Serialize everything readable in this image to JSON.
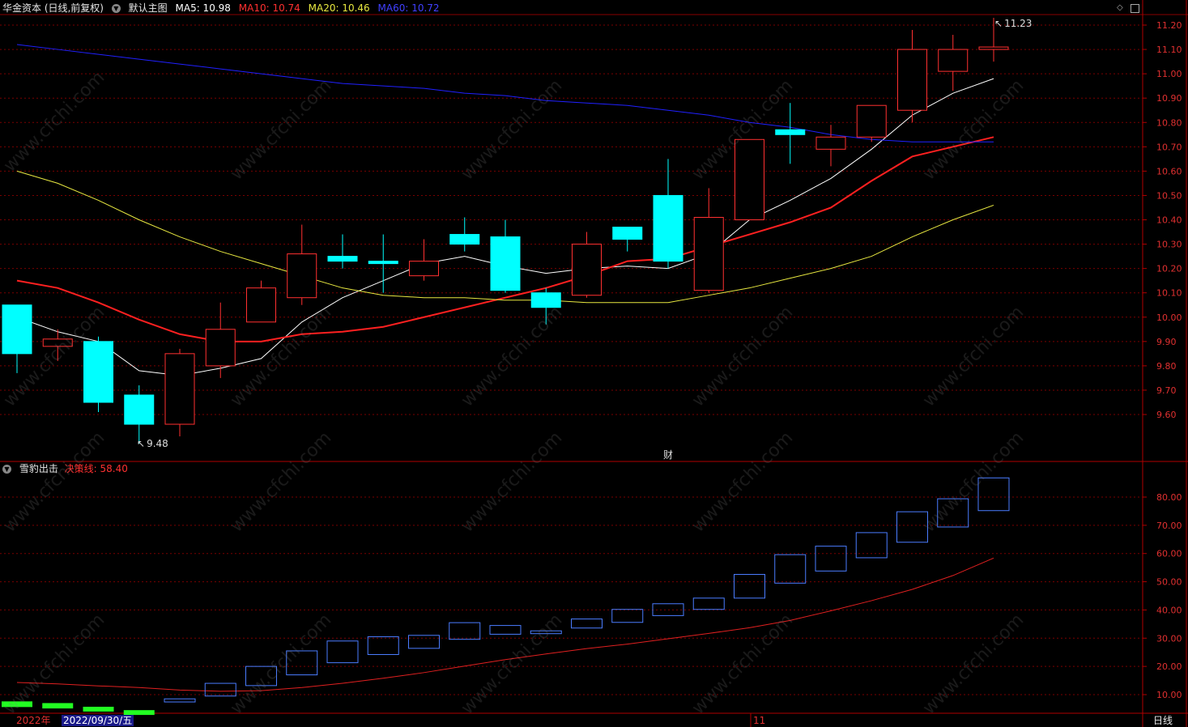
{
  "header": {
    "stock_name": "华金资本 (日线,前复权)",
    "main_chart_label": "默认主图",
    "ma5_label": "MA5: 10.98",
    "ma10_label": "MA10: 10.74",
    "ma20_label": "MA20: 10.46",
    "ma60_label": "MA60: 10.72"
  },
  "sub_header": {
    "indicator_name": "雪豹出击",
    "decision_label": "决策线: 58.40"
  },
  "annotations": {
    "high_mark": "11.23",
    "low_mark": "9.48",
    "finance_marker": "财"
  },
  "footer": {
    "year_label": "2022年",
    "date_label": "2022/09/30/五",
    "month_label": "11",
    "period_button": "日线"
  },
  "watermark": "www.cfchi.com",
  "colors": {
    "up": "#ff3030",
    "down": "#00ffff",
    "ma5": "#ffffff",
    "ma10": "#ff2020",
    "ma20": "#e8e840",
    "ma60": "#2020ff",
    "grid": "#7a0000",
    "axis_text": "#e03030",
    "indicator_box": "#4a7cff",
    "indicator_neg": "#22ff22",
    "decision_line": "#e02020"
  },
  "chart_data": [
    {
      "type": "candlestick",
      "title": "华金资本 (日线,前复权)",
      "y_ticks": [
        9.6,
        9.7,
        9.8,
        9.9,
        10.0,
        10.1,
        10.2,
        10.3,
        10.4,
        10.5,
        10.6,
        10.7,
        10.8,
        10.9,
        11.0,
        11.1,
        11.2
      ],
      "ylim": [
        9.45,
        11.25
      ],
      "grid": true,
      "candles": [
        {
          "o": 10.05,
          "h": 10.05,
          "l": 9.77,
          "c": 9.85
        },
        {
          "o": 9.88,
          "h": 9.95,
          "l": 9.82,
          "c": 9.91
        },
        {
          "o": 9.9,
          "h": 9.92,
          "l": 9.61,
          "c": 9.65
        },
        {
          "o": 9.68,
          "h": 9.72,
          "l": 9.48,
          "c": 9.56
        },
        {
          "o": 9.56,
          "h": 9.87,
          "l": 9.51,
          "c": 9.85
        },
        {
          "o": 9.8,
          "h": 10.06,
          "l": 9.75,
          "c": 9.95
        },
        {
          "o": 9.98,
          "h": 10.15,
          "l": 9.98,
          "c": 10.12
        },
        {
          "o": 10.08,
          "h": 10.38,
          "l": 10.05,
          "c": 10.26
        },
        {
          "o": 10.25,
          "h": 10.34,
          "l": 10.2,
          "c": 10.23
        },
        {
          "o": 10.23,
          "h": 10.34,
          "l": 10.1,
          "c": 10.22
        },
        {
          "o": 10.17,
          "h": 10.32,
          "l": 10.15,
          "c": 10.23
        },
        {
          "o": 10.34,
          "h": 10.41,
          "l": 10.27,
          "c": 10.3
        },
        {
          "o": 10.33,
          "h": 10.4,
          "l": 10.1,
          "c": 10.11
        },
        {
          "o": 10.1,
          "h": 10.12,
          "l": 9.97,
          "c": 10.04
        },
        {
          "o": 10.09,
          "h": 10.35,
          "l": 10.08,
          "c": 10.3
        },
        {
          "o": 10.37,
          "h": 10.37,
          "l": 10.27,
          "c": 10.32
        },
        {
          "o": 10.5,
          "h": 10.65,
          "l": 10.2,
          "c": 10.23
        },
        {
          "o": 10.11,
          "h": 10.53,
          "l": 10.1,
          "c": 10.41
        },
        {
          "o": 10.4,
          "h": 10.73,
          "l": 10.4,
          "c": 10.73
        },
        {
          "o": 10.77,
          "h": 10.88,
          "l": 10.63,
          "c": 10.75
        },
        {
          "o": 10.69,
          "h": 10.79,
          "l": 10.62,
          "c": 10.74
        },
        {
          "o": 10.74,
          "h": 10.86,
          "l": 10.72,
          "c": 10.87
        },
        {
          "o": 10.85,
          "h": 11.18,
          "l": 10.8,
          "c": 11.1
        },
        {
          "o": 11.01,
          "h": 11.16,
          "l": 10.93,
          "c": 11.1
        },
        {
          "o": 11.1,
          "h": 11.23,
          "l": 11.05,
          "c": 11.11
        }
      ],
      "series": [
        {
          "name": "MA5",
          "values": [
            10.0,
            9.94,
            9.9,
            9.78,
            9.76,
            9.79,
            9.83,
            9.98,
            10.08,
            10.15,
            10.22,
            10.25,
            10.21,
            10.18,
            10.2,
            10.21,
            10.2,
            10.26,
            10.4,
            10.48,
            10.57,
            10.69,
            10.83,
            10.92,
            10.98
          ]
        },
        {
          "name": "MA10",
          "values": [
            10.15,
            10.12,
            10.06,
            9.99,
            9.93,
            9.9,
            9.9,
            9.93,
            9.94,
            9.96,
            10.0,
            10.04,
            10.08,
            10.12,
            10.17,
            10.23,
            10.24,
            10.29,
            10.34,
            10.39,
            10.45,
            10.56,
            10.66,
            10.7,
            10.74
          ]
        },
        {
          "name": "MA20",
          "values": [
            10.6,
            10.55,
            10.48,
            10.4,
            10.33,
            10.27,
            10.22,
            10.17,
            10.12,
            10.09,
            10.08,
            10.08,
            10.07,
            10.07,
            10.06,
            10.06,
            10.06,
            10.09,
            10.12,
            10.16,
            10.2,
            10.25,
            10.33,
            10.4,
            10.46
          ]
        },
        {
          "name": "MA60",
          "values": [
            11.12,
            11.1,
            11.08,
            11.06,
            11.04,
            11.02,
            11.0,
            10.98,
            10.96,
            10.95,
            10.94,
            10.92,
            10.91,
            10.89,
            10.88,
            10.87,
            10.85,
            10.83,
            10.8,
            10.78,
            10.75,
            10.73,
            10.72,
            10.72,
            10.72
          ]
        }
      ]
    },
    {
      "type": "bar",
      "title": "雪豹出击",
      "y_ticks": [
        10,
        20,
        30,
        40,
        50,
        60,
        70,
        80
      ],
      "ylim": [
        5,
        90
      ],
      "grid": true,
      "boxes": [
        {
          "top": 7.6,
          "bottom": 5.6,
          "neg": true
        },
        {
          "top": 7.0,
          "bottom": 5.1,
          "neg": true
        },
        {
          "top": 5.7,
          "bottom": 4.0,
          "neg": true
        },
        {
          "top": 4.5,
          "bottom": 2.8,
          "neg": true
        },
        {
          "top": 8.5,
          "bottom": 7.4,
          "neg": false
        },
        {
          "top": 14.0,
          "bottom": 9.5,
          "neg": false
        },
        {
          "top": 20.0,
          "bottom": 13.2,
          "neg": false
        },
        {
          "top": 25.5,
          "bottom": 17.0,
          "neg": false
        },
        {
          "top": 29.0,
          "bottom": 21.3,
          "neg": false
        },
        {
          "top": 30.5,
          "bottom": 24.2,
          "neg": false
        },
        {
          "top": 31.0,
          "bottom": 26.4,
          "neg": false
        },
        {
          "top": 35.5,
          "bottom": 29.6,
          "neg": false
        },
        {
          "top": 34.5,
          "bottom": 31.4,
          "neg": false
        },
        {
          "top": 32.6,
          "bottom": 31.6,
          "neg": false
        },
        {
          "top": 36.8,
          "bottom": 33.6,
          "neg": false
        },
        {
          "top": 40.2,
          "bottom": 35.6,
          "neg": false
        },
        {
          "top": 42.2,
          "bottom": 38.0,
          "neg": false
        },
        {
          "top": 44.2,
          "bottom": 40.2,
          "neg": false
        },
        {
          "top": 52.6,
          "bottom": 44.2,
          "neg": false
        },
        {
          "top": 59.6,
          "bottom": 49.5,
          "neg": false
        },
        {
          "top": 62.6,
          "bottom": 53.8,
          "neg": false
        },
        {
          "top": 67.4,
          "bottom": 58.5,
          "neg": false
        },
        {
          "top": 74.8,
          "bottom": 64.0,
          "neg": false
        },
        {
          "top": 79.4,
          "bottom": 69.4,
          "neg": false
        },
        {
          "top": 86.8,
          "bottom": 75.2,
          "neg": false
        }
      ],
      "series": [
        {
          "name": "决策线",
          "values": [
            14.3,
            13.8,
            13.1,
            12.5,
            11.6,
            11.2,
            11.4,
            12.5,
            14.0,
            15.8,
            17.8,
            20.1,
            22.4,
            24.4,
            26.3,
            27.9,
            29.8,
            31.7,
            33.7,
            36.3,
            39.7,
            43.3,
            47.3,
            52.2,
            58.4
          ]
        }
      ]
    }
  ]
}
